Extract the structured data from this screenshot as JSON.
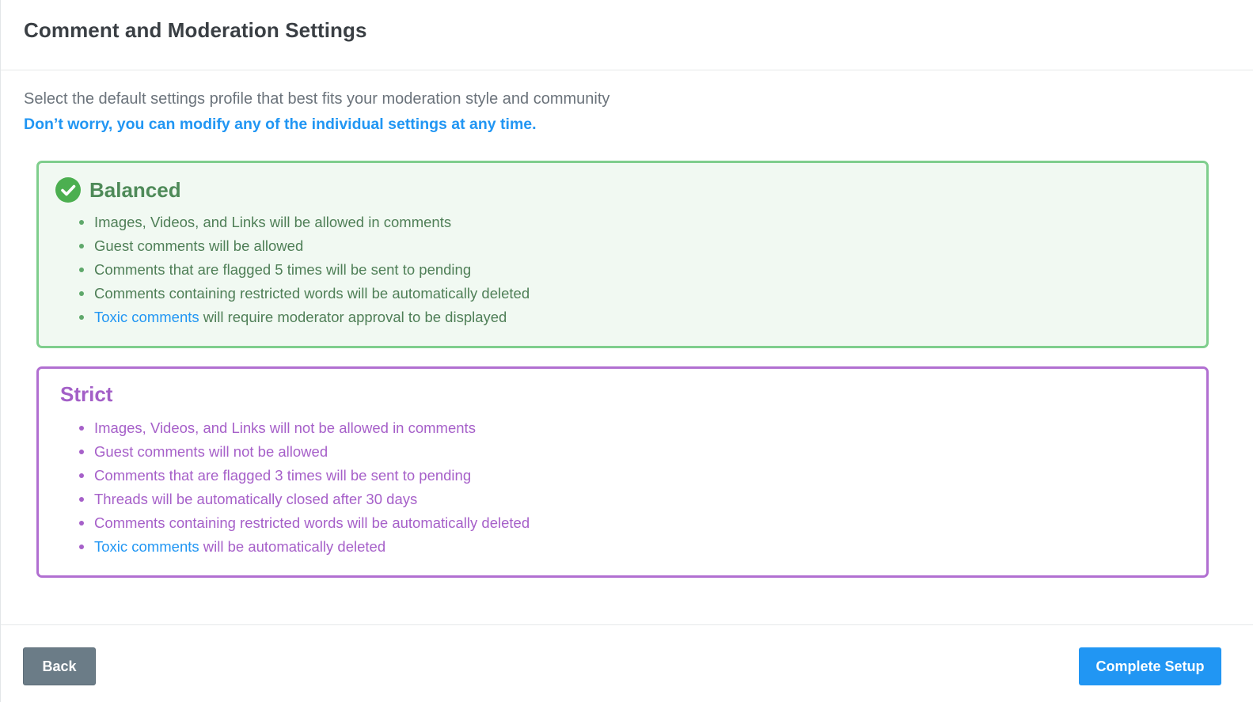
{
  "header": {
    "title": "Comment and Moderation Settings"
  },
  "intro": {
    "description": "Select the default settings profile that best fits your moderation style and community",
    "note": "Don’t worry, you can modify any of the individual settings at any time."
  },
  "profiles": {
    "balanced": {
      "title": "Balanced",
      "selected": true,
      "items": [
        {
          "text": "Images, Videos, and Links will be allowed in comments"
        },
        {
          "text": "Guest comments will be allowed"
        },
        {
          "text": "Comments that are flagged 5 times will be sent to pending"
        },
        {
          "text": "Comments containing restricted words will be automatically deleted"
        },
        {
          "link": "Toxic comments",
          "text": " will require moderator approval to be displayed"
        }
      ]
    },
    "strict": {
      "title": "Strict",
      "selected": false,
      "items": [
        {
          "text": "Images, Videos, and Links will not be allowed in comments"
        },
        {
          "text": "Guest comments will not be allowed"
        },
        {
          "text": "Comments that are flagged 3 times will be sent to pending"
        },
        {
          "text": "Threads will be automatically closed after 30 days"
        },
        {
          "text": "Comments containing restricted words will be automatically deleted"
        },
        {
          "link": "Toxic comments",
          "text": " will be automatically deleted"
        }
      ]
    }
  },
  "footer": {
    "back_label": "Back",
    "complete_label": "Complete Setup"
  },
  "colors": {
    "accent": "#2196f3",
    "balanced_border": "#7fce8d",
    "balanced_bg": "#f1f9f2",
    "strict_border": "#b16fd1",
    "back_button": "#6b7c87"
  },
  "icons": {
    "selected": "check-circle-icon"
  }
}
